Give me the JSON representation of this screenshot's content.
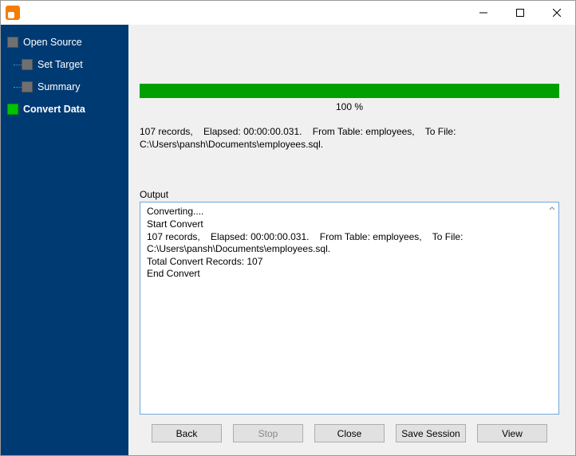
{
  "window": {
    "title": ""
  },
  "sidebar": {
    "steps": [
      {
        "label": "Open Source",
        "active": false
      },
      {
        "label": "Set Target",
        "active": false
      },
      {
        "label": "Summary",
        "active": false
      },
      {
        "label": "Convert Data",
        "active": true
      }
    ]
  },
  "progress": {
    "percent_label": "100 %",
    "percent_value": 100
  },
  "summary_text": "107 records,    Elapsed: 00:00:00.031.    From Table: employees,    To File: C:\\Users\\pansh\\Documents\\employees.sql.",
  "output": {
    "label": "Output",
    "text": "Converting....\nStart Convert\n107 records,    Elapsed: 00:00:00.031.    From Table: employees,    To File: C:\\Users\\pansh\\Documents\\employees.sql.\nTotal Convert Records: 107\nEnd Convert\n"
  },
  "buttons": {
    "back": "Back",
    "stop": "Stop",
    "close": "Close",
    "save_session": "Save Session",
    "view": "View"
  }
}
